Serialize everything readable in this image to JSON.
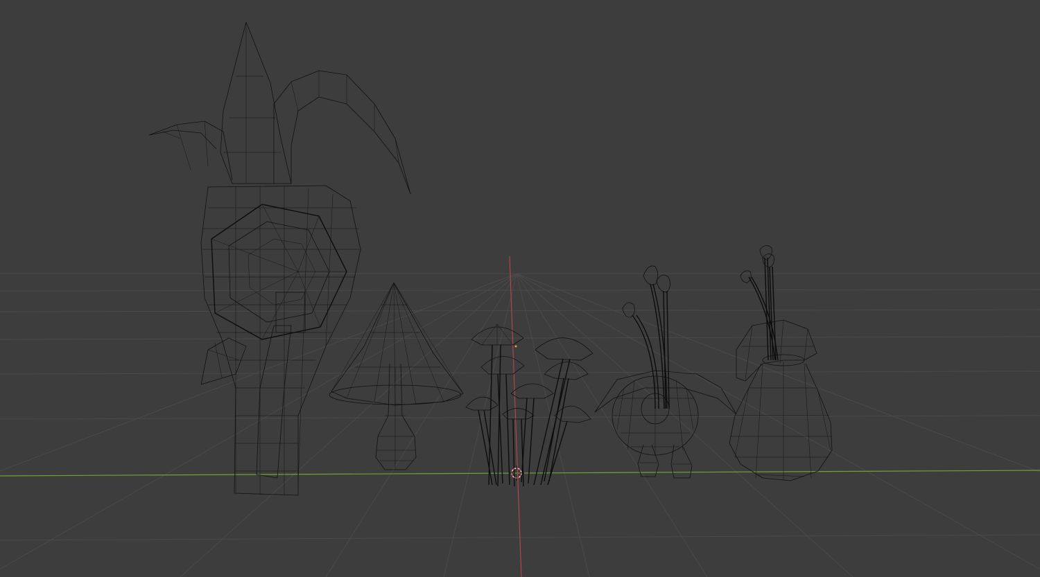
{
  "viewport": {
    "background_color": "#3d3d3d",
    "grid_color": "#4a4a4a",
    "x_axis_color": "#6ea33a",
    "y_axis_color": "#c2484f",
    "wire_color": "#111111",
    "cursor_color": "#e8e8e8",
    "objects": [
      "plant-leaves",
      "cone-mushroom",
      "mushroom-cluster",
      "round-bulb-plant",
      "pear-vase-plant"
    ]
  }
}
